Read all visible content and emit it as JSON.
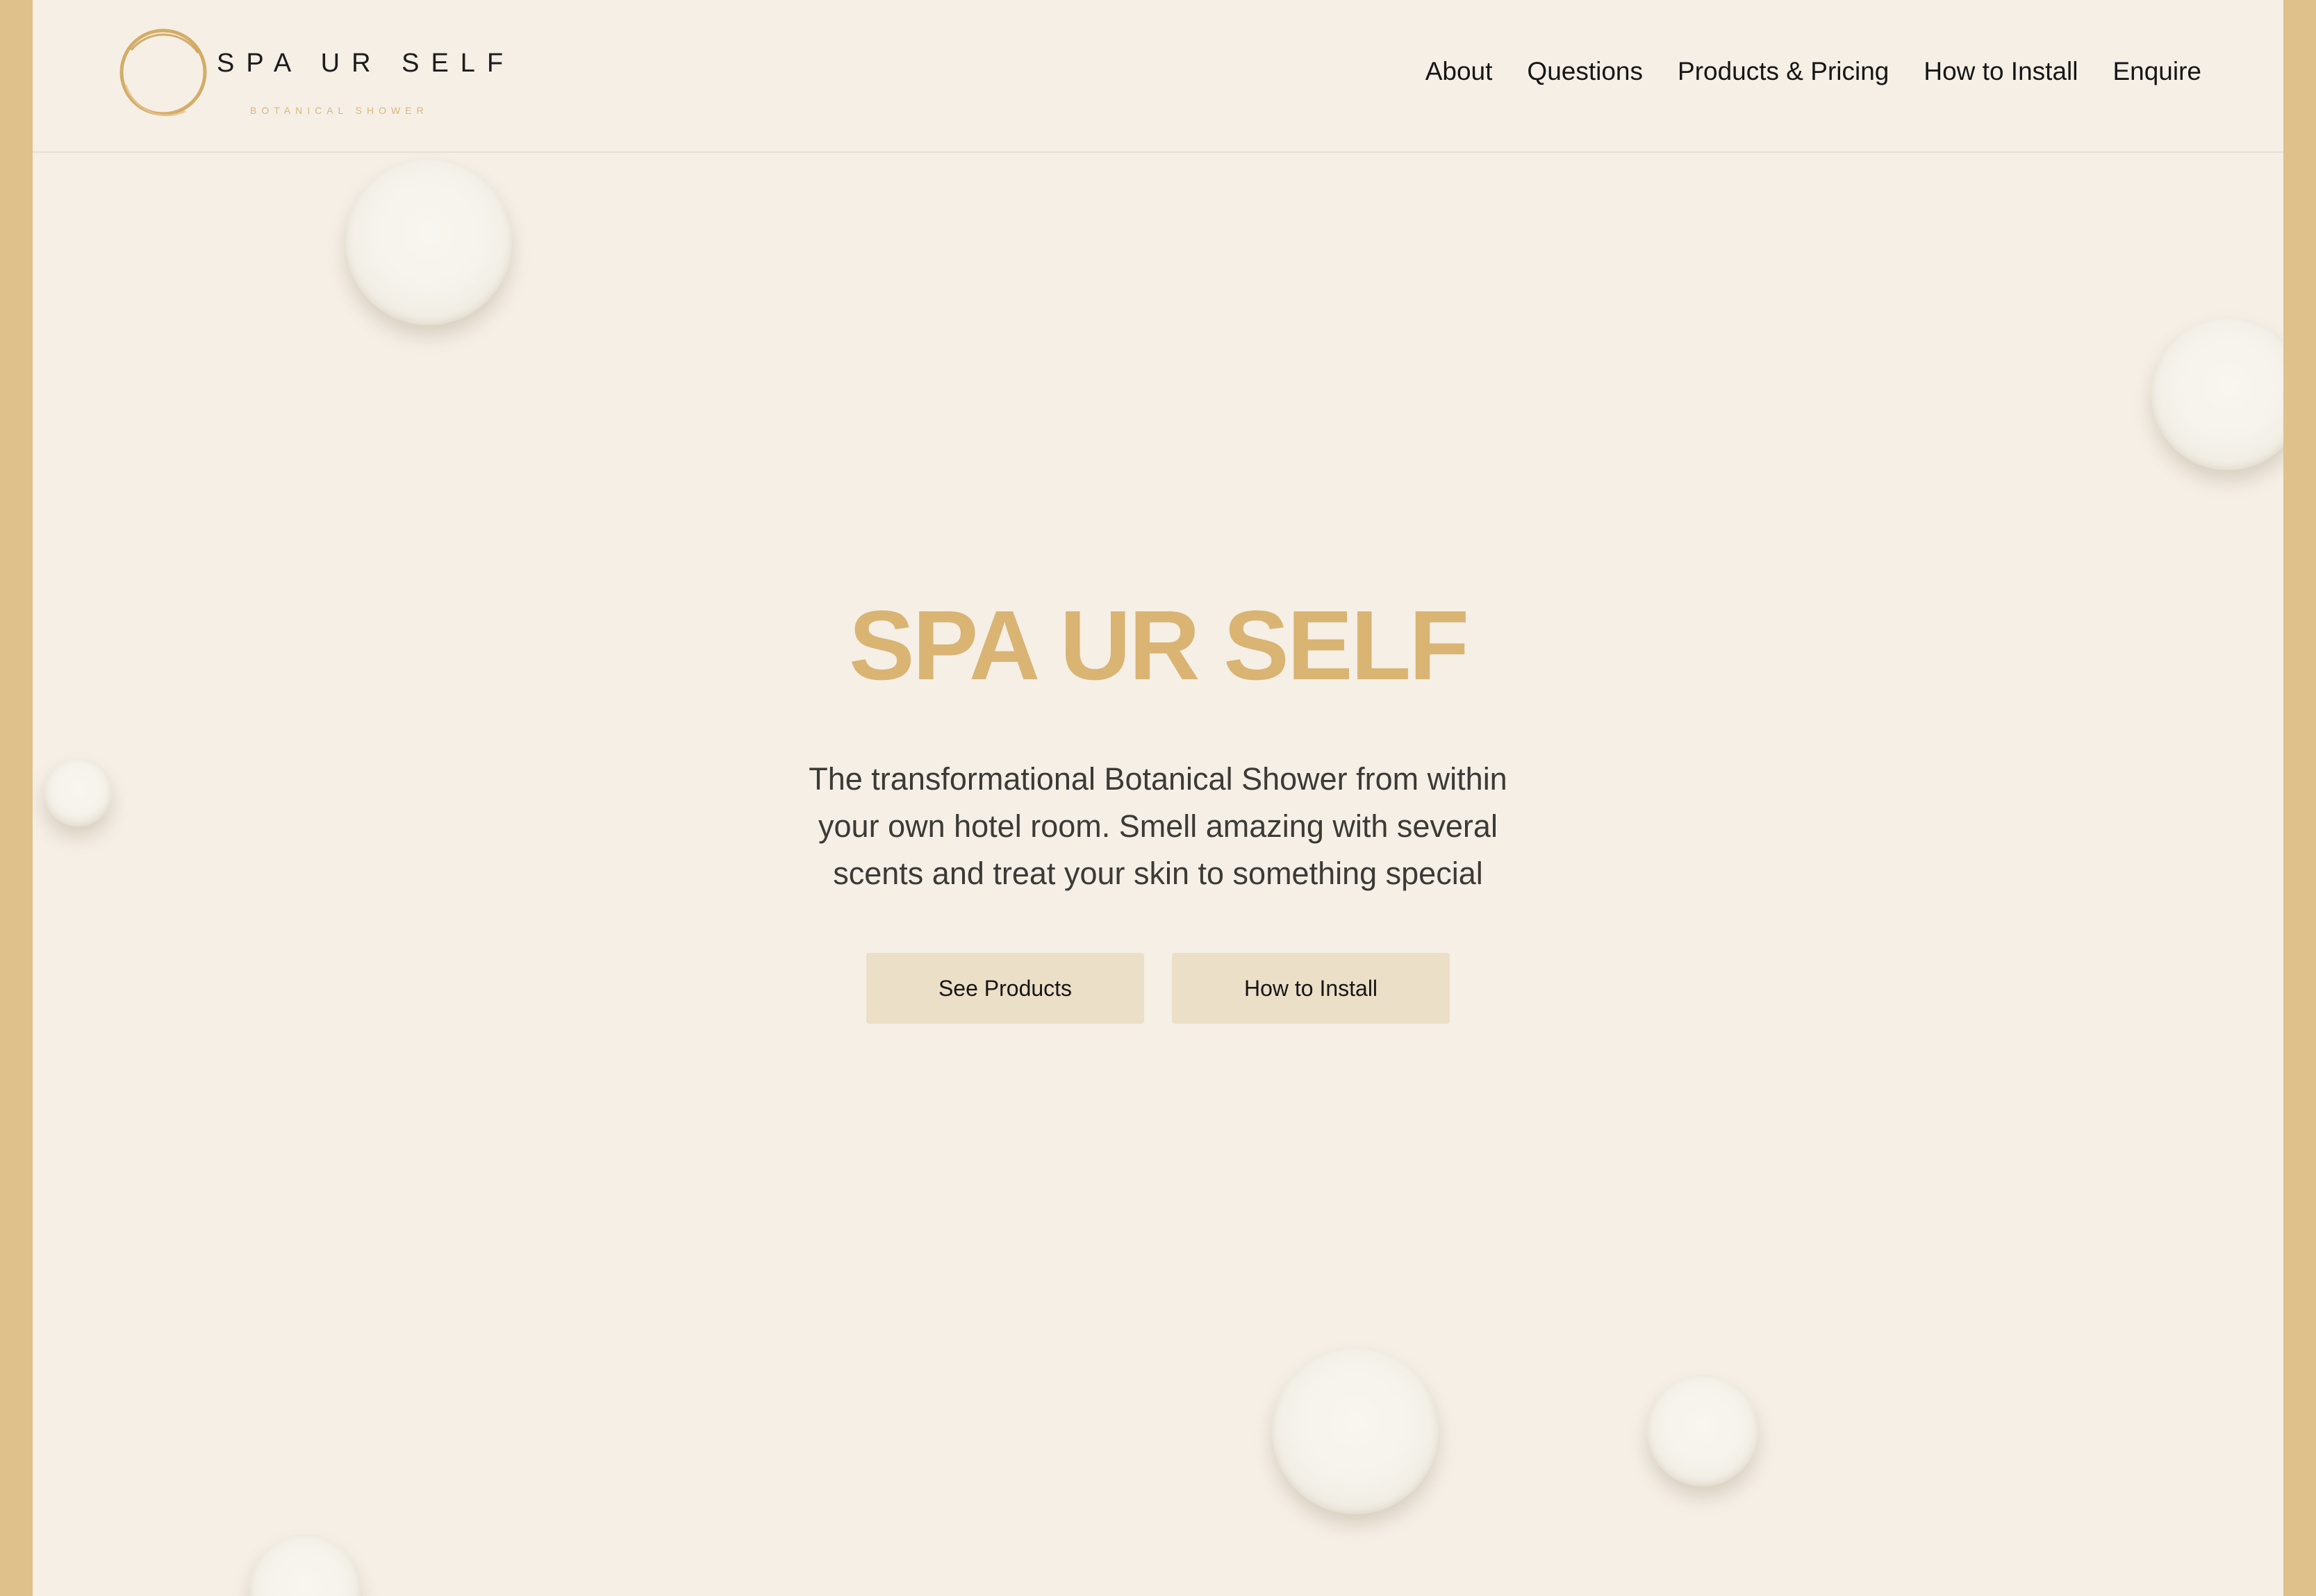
{
  "brand": {
    "wordmark": "SPA UR SELF",
    "tagline": "BOTANICAL SHOWER",
    "accent_color": "#d9b473"
  },
  "nav": {
    "items": [
      {
        "label": "About"
      },
      {
        "label": "Questions"
      },
      {
        "label": "Products & Pricing"
      },
      {
        "label": "How to Install"
      },
      {
        "label": "Enquire"
      }
    ]
  },
  "hero": {
    "title": "SPA UR SELF",
    "description": "The transformational Botanical Shower from within your own hotel room. Smell amazing with several scents and treat your skin to something special",
    "buttons": {
      "primary": "See Products",
      "secondary": "How to Install"
    }
  },
  "colors": {
    "frame": "#dfc18b",
    "background": "#f5efe6",
    "button_bg": "#ecdfc7"
  }
}
